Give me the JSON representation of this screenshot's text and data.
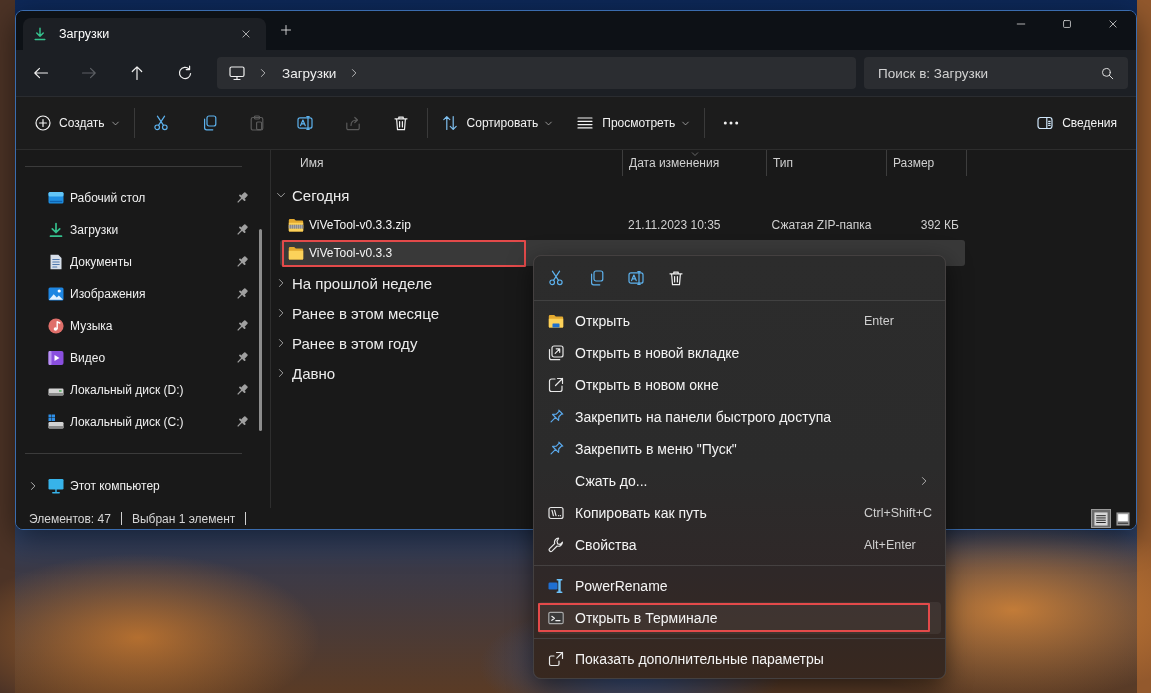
{
  "tabs": [
    {
      "label": "Загрузки",
      "selected": true
    }
  ],
  "navigation": [
    {
      "kind": "back",
      "disabled": false
    },
    {
      "kind": "forward",
      "disabled": true
    },
    {
      "kind": "up",
      "disabled": false
    },
    {
      "kind": "refresh",
      "disabled": false
    }
  ],
  "address_bar": {
    "path": [
      "Загрузки"
    ]
  },
  "search": {
    "placeholder": "Поиск в: Загрузки"
  },
  "toolbar": {
    "groups": [
      {
        "items": [
          {
            "kind": "new",
            "label": "Создать",
            "dropdown": true,
            "disabled": false
          }
        ]
      },
      {
        "items": [
          {
            "kind": "cut",
            "disabled": false
          },
          {
            "kind": "copy",
            "disabled": false
          },
          {
            "kind": "paste",
            "disabled": true
          },
          {
            "kind": "rename",
            "disabled": false
          },
          {
            "kind": "share",
            "disabled": true
          },
          {
            "kind": "delete",
            "disabled": false
          }
        ]
      },
      {
        "items": [
          {
            "kind": "sort",
            "label": "Сортировать",
            "dropdown": true,
            "disabled": false
          },
          {
            "kind": "view",
            "label": "Просмотреть",
            "dropdown": true,
            "disabled": false
          }
        ]
      },
      {
        "items": [
          {
            "kind": "more",
            "disabled": false
          }
        ]
      }
    ],
    "details": {
      "label": "Сведения"
    }
  },
  "sidebar": {
    "quick_access": [
      {
        "kind": "desktop",
        "label": "Рабочий стол",
        "pinned": true
      },
      {
        "kind": "downloads",
        "label": "Загрузки",
        "pinned": true
      },
      {
        "kind": "documents",
        "label": "Документы",
        "pinned": true
      },
      {
        "kind": "pictures",
        "label": "Изображения",
        "pinned": true
      },
      {
        "kind": "music",
        "label": "Музыка",
        "pinned": true
      },
      {
        "kind": "videos",
        "label": "Видео",
        "pinned": true
      },
      {
        "kind": "drive",
        "label": "Локальный диск (D:)",
        "pinned": true
      },
      {
        "kind": "system_drive",
        "label": "Локальный диск (C:)",
        "pinned": true
      }
    ],
    "this_pc": {
      "label": "Этот компьютер",
      "expanded": false
    }
  },
  "file_list": {
    "columns": [
      {
        "label": "Имя",
        "sorted": false
      },
      {
        "label": "Дата изменения",
        "sorted": true
      },
      {
        "label": "Тип",
        "sorted": false
      },
      {
        "label": "Размер",
        "sorted": false
      }
    ],
    "groups": [
      {
        "label": "Сегодня",
        "expanded": true,
        "files": [
          {
            "kind": "zip",
            "name": "ViVeTool-v0.3.3.zip",
            "modified": "21.11.2023 10:35",
            "type": "Сжатая ZIP-папка",
            "size": "392 КБ",
            "selected": false,
            "framed": false
          },
          {
            "kind": "folder",
            "name": "ViVeTool-v0.3.3",
            "selected": true,
            "framed": true
          }
        ]
      },
      {
        "label": "На прошлой неделе",
        "expanded": false
      },
      {
        "label": "Ранее в этом месяце",
        "expanded": false
      },
      {
        "label": "Ранее в этом году",
        "expanded": false
      },
      {
        "label": "Давно",
        "expanded": false
      }
    ]
  },
  "status_bar": {
    "items": [
      "Элементов: 47",
      "Выбран 1 элемент"
    ],
    "views": [
      {
        "kind": "details",
        "selected": true
      },
      {
        "kind": "tiles",
        "selected": false
      }
    ]
  },
  "context_menu": {
    "actions": [
      {
        "kind": "cut"
      },
      {
        "kind": "copy"
      },
      {
        "kind": "rename"
      },
      {
        "kind": "delete"
      }
    ],
    "sections": [
      {
        "items": [
          {
            "kind": "open",
            "label": "Открыть",
            "shortcut": "Enter",
            "submenu": false,
            "hovered": false,
            "framed": false
          },
          {
            "kind": "new_tab",
            "label": "Открыть в новой вкладке",
            "submenu": false,
            "hovered": false,
            "framed": false
          },
          {
            "kind": "new_window",
            "label": "Открыть в новом окне",
            "submenu": false,
            "hovered": false,
            "framed": false
          },
          {
            "kind": "pin",
            "label": "Закрепить на панели быстрого доступа",
            "submenu": false,
            "hovered": false,
            "framed": false
          },
          {
            "kind": "pin",
            "label": "Закрепить в меню \"Пуск\"",
            "submenu": false,
            "hovered": false,
            "framed": false
          },
          {
            "kind": "compress",
            "label": "Сжать до...",
            "submenu": true,
            "hovered": false,
            "framed": false
          },
          {
            "kind": "copy_path",
            "label": "Копировать как путь",
            "shortcut": "Ctrl+Shift+C",
            "submenu": false,
            "hovered": false,
            "framed": false
          },
          {
            "kind": "properties",
            "label": "Свойства",
            "shortcut": "Alt+Enter",
            "submenu": false,
            "hovered": false,
            "framed": false
          }
        ]
      },
      {
        "items": [
          {
            "kind": "power_rename",
            "label": "PowerRename",
            "submenu": false,
            "hovered": false,
            "framed": false
          },
          {
            "kind": "terminal",
            "label": "Открыть в Терминале",
            "submenu": false,
            "hovered": true,
            "framed": true
          }
        ]
      },
      {
        "items": [
          {
            "kind": "more_options",
            "label": "Показать дополнительные параметры",
            "submenu": false,
            "hovered": false,
            "framed": false
          }
        ]
      }
    ]
  }
}
